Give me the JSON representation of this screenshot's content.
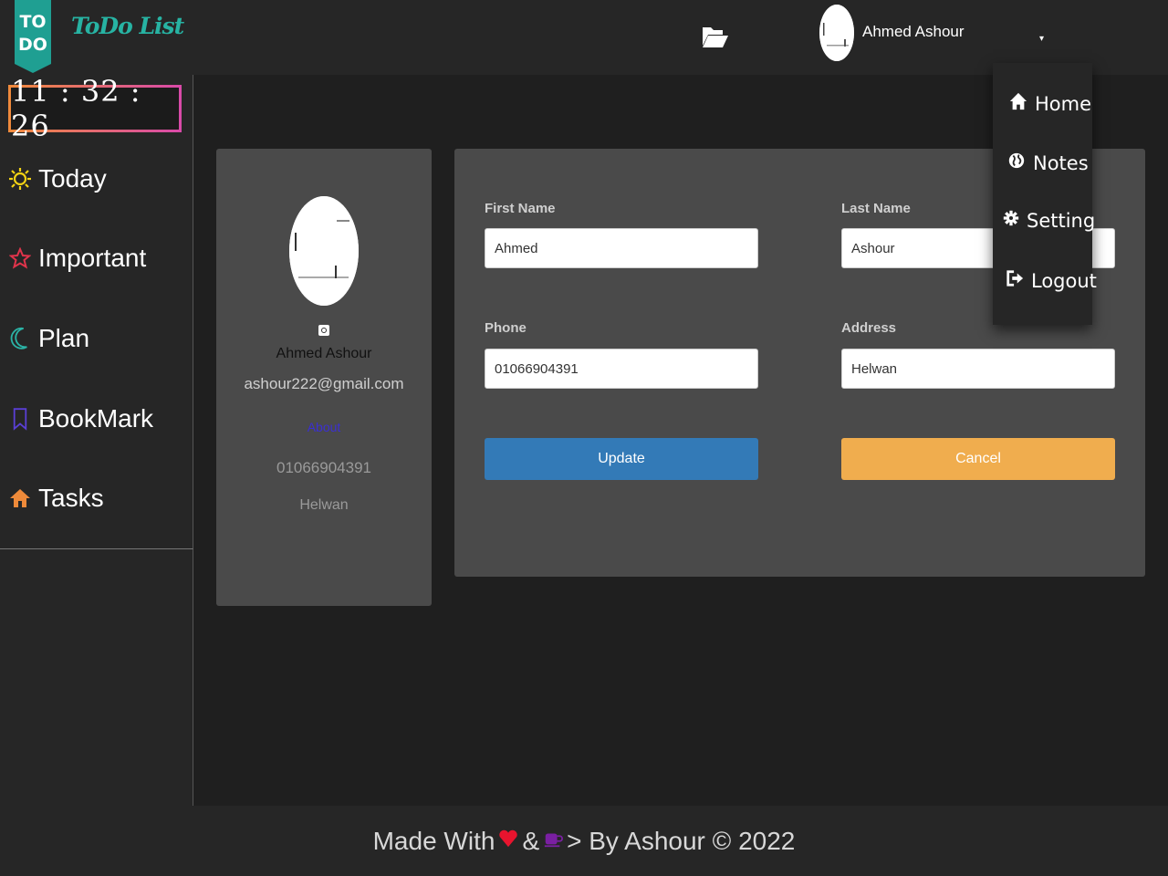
{
  "app": {
    "logo_badge_line1": "TO",
    "logo_badge_line2": "DO",
    "logo_text": "ToDo List"
  },
  "header": {
    "user_name": "Ahmed Ashour",
    "caret": "▾"
  },
  "clock": {
    "time": "11 : 32 : 26"
  },
  "sidebar": {
    "items": [
      {
        "label": "Today",
        "icon": "sun-icon",
        "color": "#f3d314"
      },
      {
        "label": "Important",
        "icon": "star-icon",
        "color": "#e0344b"
      },
      {
        "label": "Plan",
        "icon": "moon-icon",
        "color": "#2bb3a6"
      },
      {
        "label": "BookMark",
        "icon": "bookmark-icon",
        "color": "#5a3fd6"
      },
      {
        "label": "Tasks",
        "icon": "home-icon",
        "color": "#ee8a3a"
      }
    ]
  },
  "profile": {
    "name": "Ahmed  Ashour",
    "email": "ashour222@gmail.com",
    "about": "About",
    "phone": "01066904391",
    "city": "Helwan"
  },
  "form": {
    "first_name_label": "First Name",
    "first_name_value": "Ahmed",
    "last_name_label": "Last Name",
    "last_name_value": "Ashour",
    "phone_label": "Phone",
    "phone_value": "01066904391",
    "address_label": "Address",
    "address_value": "Helwan",
    "update_label": "Update",
    "cancel_label": "Cancel"
  },
  "dropdown": {
    "items": [
      {
        "label": "Home",
        "icon": "home-icon"
      },
      {
        "label": "Notes",
        "icon": "globe-icon"
      },
      {
        "label": "Setting",
        "icon": "gear-icon"
      },
      {
        "label": "Logout",
        "icon": "logout-icon"
      }
    ]
  },
  "footer": {
    "made_with": "Made With",
    "amp": "&",
    "by": "> By Ashour © 2022"
  },
  "colors": {
    "accent_teal": "#27b3a3",
    "update_blue": "#337ab7",
    "cancel_orange": "#f0ad4e"
  }
}
